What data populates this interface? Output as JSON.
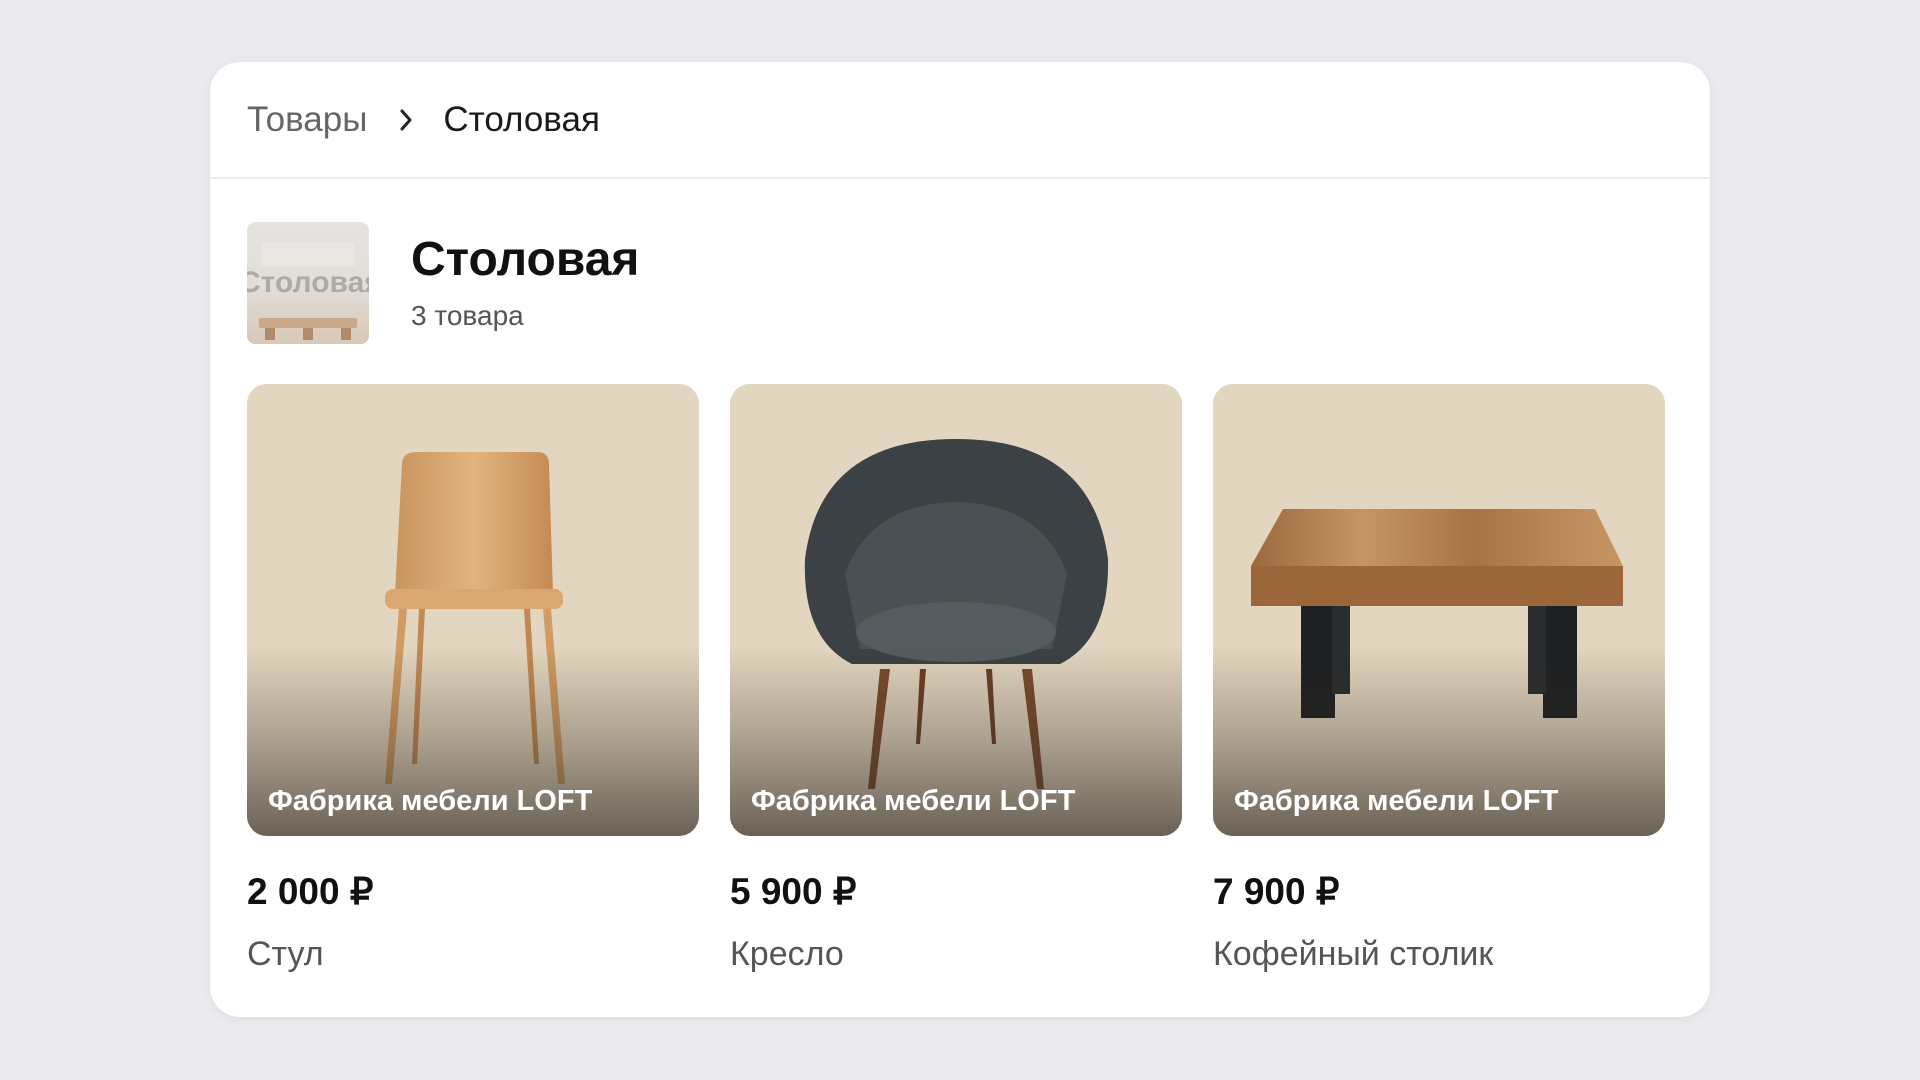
{
  "breadcrumb": {
    "parent": "Товары",
    "current": "Столовая"
  },
  "collection": {
    "thumbnail_text": "Столовая",
    "title": "Столовая",
    "count": "3 товара"
  },
  "products": [
    {
      "vendor": "Фабрика мебели LOFT",
      "price": "2 000 ₽",
      "name": "Стул"
    },
    {
      "vendor": "Фабрика мебели LOFT",
      "price": "5 900 ₽",
      "name": "Кресло"
    },
    {
      "vendor": "Фабрика мебели LOFT",
      "price": "7 900 ₽",
      "name": "Кофейный столик"
    }
  ],
  "colors": {
    "page_bg": "#ebebef",
    "card_bg": "#ffffff",
    "image_bg": "#e2d5bf",
    "text": "#111111",
    "muted": "#555555"
  }
}
